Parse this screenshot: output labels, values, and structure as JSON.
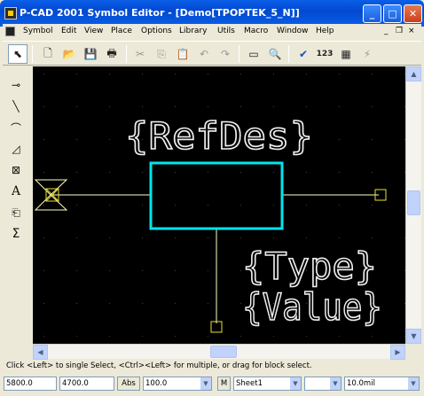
{
  "window": {
    "title": "P-CAD 2001 Symbol Editor - [Demo[TPOPTEK_5_N]]",
    "controls": {
      "minimize": "_",
      "maximize": "□",
      "close": "✕"
    }
  },
  "menu": {
    "items": [
      "Symbol",
      "Edit",
      "View",
      "Place",
      "Options",
      "Library",
      "Utils",
      "Macro",
      "Window",
      "Help"
    ],
    "mdi_controls": {
      "minimize": "_",
      "restore": "❐",
      "close": "×"
    }
  },
  "toolbar": {
    "buttons": [
      {
        "name": "select-tool",
        "icon": "arrow-cursor-icon",
        "glyph": "⬉"
      },
      {
        "name": "new-file",
        "icon": "new-file-icon",
        "glyph": "🗋"
      },
      {
        "name": "open-file",
        "icon": "folder-open-icon",
        "glyph": "📂"
      },
      {
        "name": "save-file",
        "icon": "floppy-disk-icon",
        "glyph": "💾"
      },
      {
        "name": "print",
        "icon": "printer-icon",
        "glyph": "🖶"
      },
      {
        "name": "cut",
        "icon": "scissors-icon",
        "glyph": "✂"
      },
      {
        "name": "copy",
        "icon": "copy-icon",
        "glyph": "⎘"
      },
      {
        "name": "paste",
        "icon": "paste-icon",
        "glyph": "📋"
      },
      {
        "name": "undo",
        "icon": "undo-icon",
        "glyph": "↶"
      },
      {
        "name": "redo",
        "icon": "redo-icon",
        "glyph": "↷"
      },
      {
        "name": "zoom-extents",
        "icon": "ruler-icon",
        "glyph": "▭"
      },
      {
        "name": "zoom",
        "icon": "magnifier-icon",
        "glyph": "🔍"
      },
      {
        "name": "validate",
        "icon": "checkmark-icon",
        "glyph": "✔"
      },
      {
        "name": "pin-numbers",
        "icon": "numbers-123-icon",
        "glyph": "123"
      },
      {
        "name": "symbol-wizard",
        "icon": "wizard-icon",
        "glyph": "▦"
      },
      {
        "name": "flash",
        "icon": "lightning-icon",
        "glyph": "⚡"
      }
    ]
  },
  "placement_tools": [
    {
      "name": "place-pin",
      "icon": "pin-icon",
      "glyph": "⊸"
    },
    {
      "name": "place-line",
      "icon": "line-icon",
      "glyph": "╲"
    },
    {
      "name": "place-arc",
      "icon": "arc-icon",
      "glyph": "⌒"
    },
    {
      "name": "place-polygon",
      "icon": "polygon-icon",
      "glyph": "◿"
    },
    {
      "name": "place-ref-point",
      "icon": "ref-point-icon",
      "glyph": "⊠"
    },
    {
      "name": "place-text",
      "icon": "text-icon",
      "glyph": "A"
    },
    {
      "name": "place-field",
      "icon": "field-icon",
      "glyph": "⎗"
    },
    {
      "name": "place-attribute",
      "icon": "sigma-icon",
      "glyph": "Σ"
    }
  ],
  "canvas": {
    "refdes_text": "{RefDes}",
    "type_text": "{Type}",
    "value_text": "{Value}",
    "colors": {
      "background": "#000000",
      "body": "#00e5ee",
      "pin": "#ffffc0",
      "text": "#f0f0f0",
      "grid": "#404040"
    }
  },
  "status": {
    "message": "Click <Left> to single Select, <Ctrl><Left> for multiple, or drag for block select.",
    "x_coord": "5800.0",
    "y_coord": "4700.0",
    "abs_label": "Abs",
    "grid": "100.0",
    "m_label": "M",
    "sheet": "Sheet1",
    "blank": "",
    "units": "10.0mil"
  }
}
